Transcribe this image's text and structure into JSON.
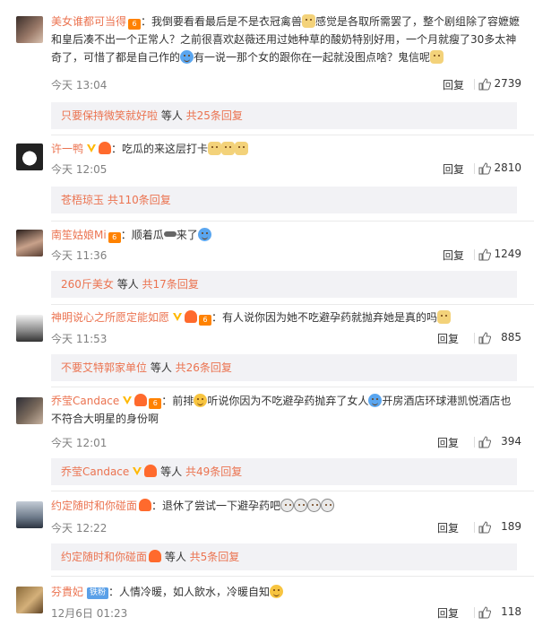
{
  "comments": [
    {
      "user": "美女谁都可当得",
      "text_a": "：我倒要看看最后是不是衣冠禽兽",
      "text_b": "感觉是各取所需罢了，整个剧组除了容嬷嬷和皇后凑不出一个正常人？之前很喜欢赵薇还用过她种草的酸奶特别好用，一个月就瘦了30多太神奇了，可惜了都是自己作的",
      "text_c": "有一说一那个女的跟你在一起就没图点啥？鬼信呢",
      "time": "今天 13:04",
      "reply": "回复",
      "likes": "2739",
      "sub": {
        "name": "只要保持微笑就好啦",
        "mid": " 等人 ",
        "count": "共25条回复"
      }
    },
    {
      "user": "许一鸭",
      "text_a": "：吃瓜的来这层打卡",
      "time": "今天 12:05",
      "reply": "回复",
      "likes": "2810",
      "sub": {
        "name": "苍梧琼玉",
        "mid": " ",
        "count": "共110条回复"
      }
    },
    {
      "user": "南笙姑娘Mi",
      "text_a": "：顺着瓜",
      "text_b": "来了",
      "time": "今天 11:36",
      "reply": "回复",
      "likes": "1249",
      "sub": {
        "name": "260斤美女",
        "mid": " 等人 ",
        "count": "共17条回复"
      }
    },
    {
      "user": "神明说心之所愿定能如愿",
      "text_a": "：有人说你因为她不吃避孕药就抛弃她是真的吗",
      "time": "今天 11:53",
      "reply": "回复",
      "likes": "885",
      "sub": {
        "name": "不要艾特郭家单位",
        "mid": " 等人 ",
        "count": "共26条回复"
      }
    },
    {
      "user": "乔莹Candace",
      "text_a": "：前排",
      "text_b": "听说你因为不吃避孕药抛弃了女人",
      "text_c": "开房酒店环球港凯悦酒店也不符合大明星的身份啊",
      "time": "今天 12:01",
      "reply": "回复",
      "likes": "394",
      "sub": {
        "name": "乔莹Candace",
        "mid": " 等人 ",
        "count": "共49条回复"
      }
    },
    {
      "user": "约定随时和你碰面",
      "text_a": "：退休了尝试一下避孕药吧",
      "time": "今天 12:22",
      "reply": "回复",
      "likes": "189",
      "sub": {
        "name": "约定随时和你碰面",
        "mid": " 等人 ",
        "count": "共5条回复"
      }
    },
    {
      "user": "芬貴妃",
      "tag": "铁粉",
      "text_a": "：人情冷暖，如人飲水，冷暖自知",
      "time": "12月6日 01:23",
      "reply": "回复",
      "likes": "118"
    }
  ]
}
